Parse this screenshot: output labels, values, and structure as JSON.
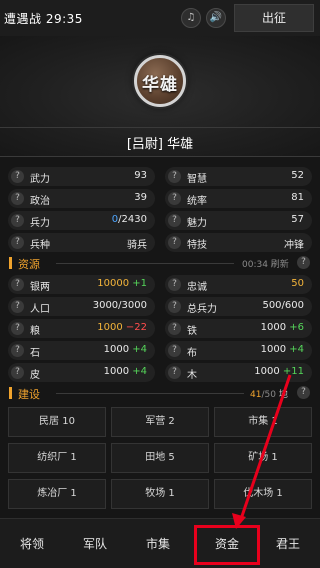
{
  "topbar": {
    "title": "遭遇战 29:35",
    "music_icon": "♫",
    "sound_icon": "🔊",
    "action_label": "出征"
  },
  "hero": {
    "emblem_text": "华雄",
    "name": "[吕尉] 华雄"
  },
  "help_icon": "?",
  "stats": [
    {
      "label": "武力",
      "value": "93"
    },
    {
      "label": "智慧",
      "value": "52"
    },
    {
      "label": "政治",
      "value": "39"
    },
    {
      "label": "统率",
      "value": "81"
    },
    {
      "label": "兵力",
      "value_current": "0",
      "value_max": "/2430"
    },
    {
      "label": "魅力",
      "value": "57"
    },
    {
      "label": "兵种",
      "value": "骑兵"
    },
    {
      "label": "特技",
      "value": "冲锋"
    }
  ],
  "resources": {
    "title": "资源",
    "refresh": "00:34 刷新",
    "items": [
      {
        "label": "银两",
        "value": "10000",
        "delta": "+1"
      },
      {
        "label": "忠诚",
        "value": "50"
      },
      {
        "label": "人口",
        "value": "3000/3000"
      },
      {
        "label": "总兵力",
        "value": "500/600"
      },
      {
        "label": "粮",
        "value": "1000",
        "delta": "−22"
      },
      {
        "label": "铁",
        "value": "1000",
        "delta": "+6"
      },
      {
        "label": "石",
        "value": "1000",
        "delta": "+4"
      },
      {
        "label": "布",
        "value": "1000",
        "delta": "+4"
      },
      {
        "label": "皮",
        "value": "1000",
        "delta": "+4"
      },
      {
        "label": "木",
        "value": "1000",
        "delta": "+11"
      }
    ]
  },
  "construction": {
    "title": "建设",
    "land_used": "41",
    "land_total": "/50",
    "land_unit": "地",
    "buildings": [
      "民居 10",
      "军营 2",
      "市集 1",
      "纺织厂 1",
      "田地 5",
      "矿场 1",
      "炼冶厂 1",
      "牧场 1",
      "伐木场 1"
    ]
  },
  "nav": [
    "将领",
    "军队",
    "市集",
    "资金",
    "君王"
  ],
  "colors": {
    "accent": "#f0a32d",
    "highlight": "#e8001c",
    "positive": "#55d65a",
    "negative": "#ff4d4d",
    "troops": "#4fa6ff",
    "gold": "#f3b43a"
  }
}
